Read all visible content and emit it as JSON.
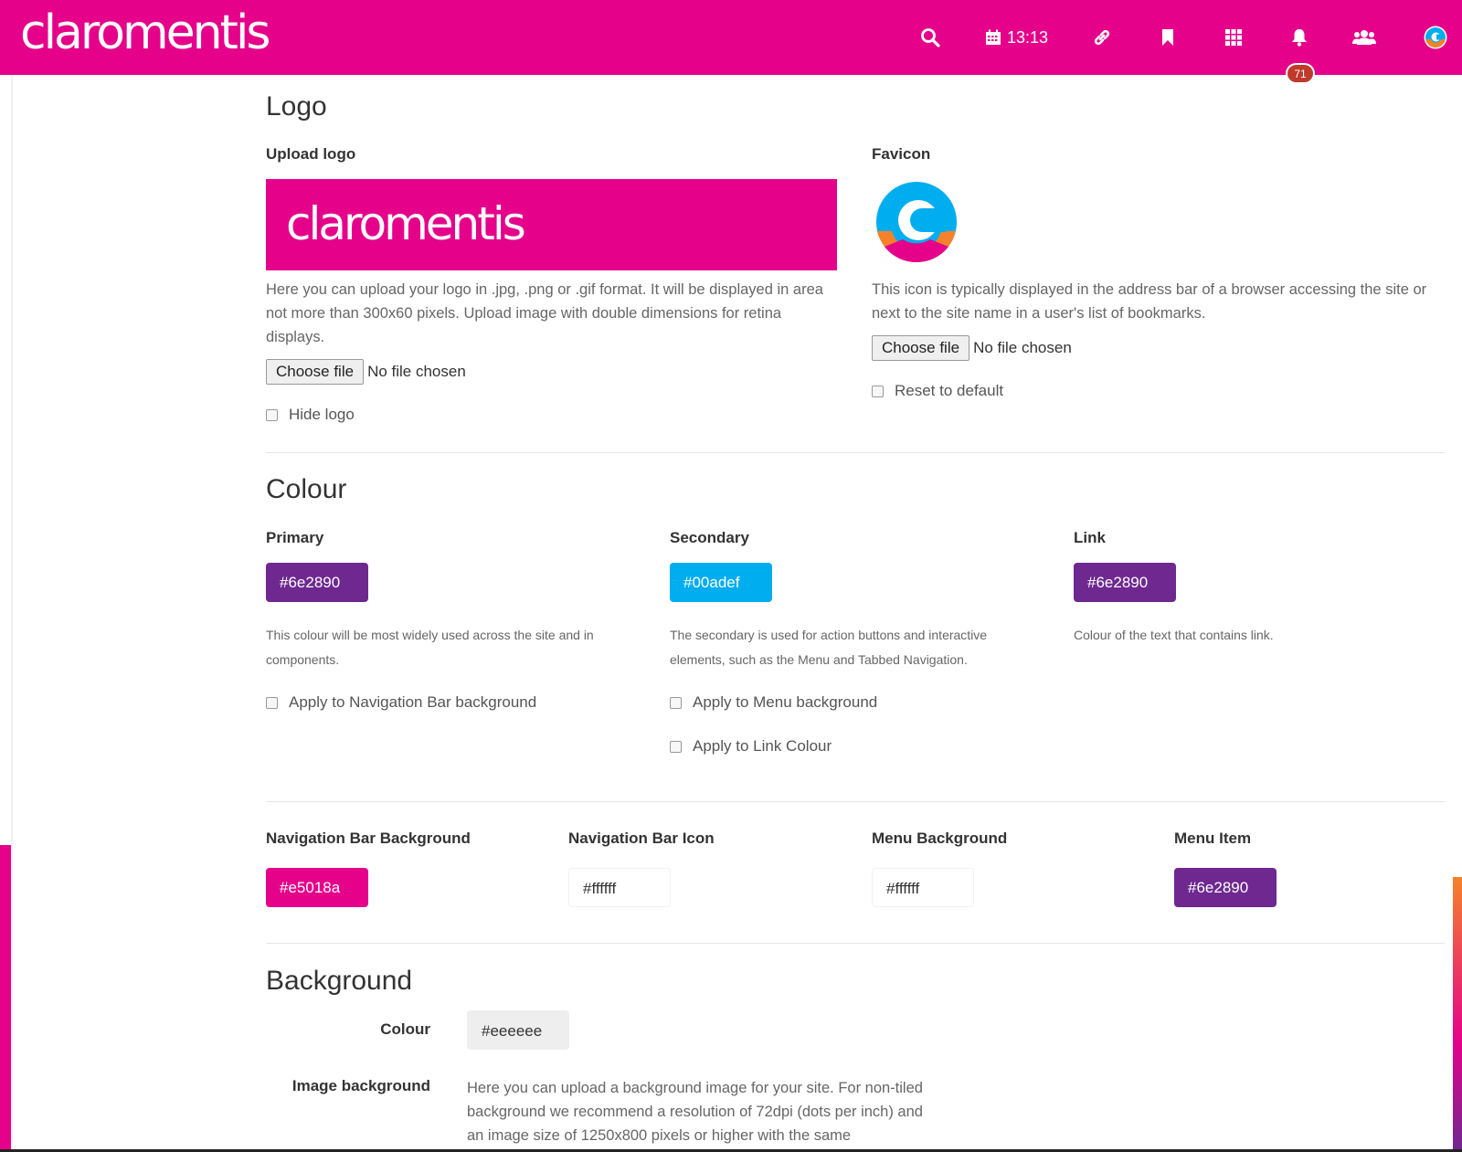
{
  "colors": {
    "brand": "#e5018a",
    "primary": "#6e2890",
    "secondary": "#00adef",
    "badge": "#c0392b"
  },
  "navbar": {
    "brand": "claromentis",
    "clock": "13:13",
    "notification_count": "71",
    "icons": [
      "search-icon",
      "calendar-icon",
      "link-icon",
      "bookmark-icon",
      "apps-grid-icon",
      "bell-icon",
      "people-icon",
      "user-avatar-icon"
    ]
  },
  "logo_section": {
    "heading": "Logo",
    "upload_label": "Upload logo",
    "preview_text": "claromentis",
    "upload_help": "Here you can upload your logo in .jpg, .png or .gif format. It will be displayed in area not more than 300x60 pixels. Upload image with double dimensions for retina displays.",
    "choose_file": "Choose file",
    "no_file": "No file chosen",
    "hide_logo": "Hide logo",
    "favicon_label": "Favicon",
    "favicon_help": "This icon is typically displayed in the address bar of a browser accessing the site or next to the site name in a user's list of bookmarks.",
    "favicon_choose_file": "Choose file",
    "favicon_no_file": "No file chosen",
    "reset_default": "Reset to default"
  },
  "colour_section": {
    "heading": "Colour",
    "primary": {
      "label": "Primary",
      "value": "#6e2890",
      "help": "This colour will be most widely used across the site and in components.",
      "option": "Apply to Navigation Bar background"
    },
    "secondary": {
      "label": "Secondary",
      "value": "#00adef",
      "help": "The secondary is used for action buttons and interactive elements, such as the Menu and Tabbed Navigation.",
      "option_menu": "Apply to Menu background",
      "option_link": "Apply to Link Colour"
    },
    "link": {
      "label": "Link",
      "value": "#6e2890",
      "help": "Colour of the text that contains link."
    },
    "nav_bar_bg": {
      "label": "Navigation Bar Background",
      "value": "#e5018a"
    },
    "nav_bar_icon": {
      "label": "Navigation Bar Icon",
      "value": "#ffffff"
    },
    "menu_bg": {
      "label": "Menu Background",
      "value": "#ffffff"
    },
    "menu_item": {
      "label": "Menu Item",
      "value": "#6e2890"
    }
  },
  "background_section": {
    "heading": "Background",
    "colour_label": "Colour",
    "colour_value": "#eeeeee",
    "image_label": "Image background",
    "image_help": "Here you can upload a background image for your site. For non-tiled background we recommend a resolution of 72dpi (dots per inch) and an image size of 1250x800 pixels or higher with the same"
  }
}
